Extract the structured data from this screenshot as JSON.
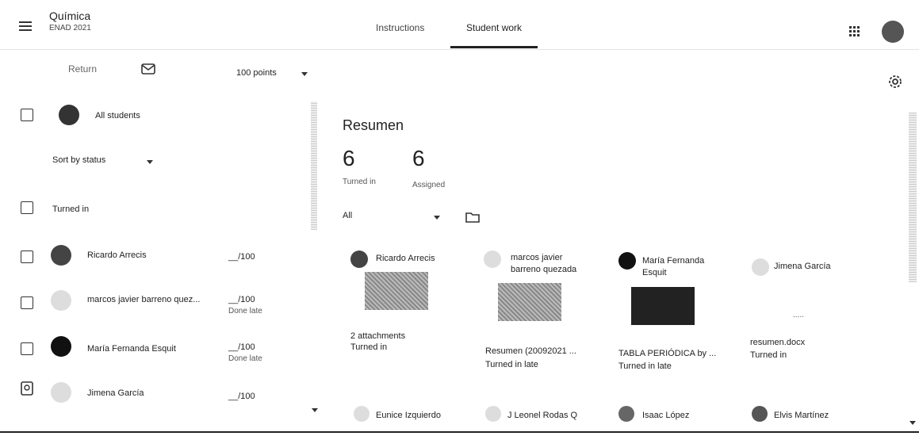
{
  "header": {
    "class_title": "Química",
    "class_subtitle": "ENAD 2021",
    "tabs": [
      {
        "label": "Instructions"
      },
      {
        "label": "Student work"
      }
    ],
    "accent": "#1e1e1e"
  },
  "toolbar": {
    "return_label": "Return",
    "points_label": "100 points"
  },
  "left": {
    "all_students": "All students",
    "sort_label": "Sort by status",
    "group_turned_in": "Turned in",
    "students": [
      {
        "name": "Ricardo Arrecis",
        "grade": "__/100",
        "status": ""
      },
      {
        "name": "marcos javier barreno quez...",
        "grade": "__/100",
        "status": "Done late"
      },
      {
        "name": "María Fernanda Esquit",
        "grade": "__/100",
        "status": "Done late"
      },
      {
        "name": "Jimena García",
        "grade": "__/100",
        "status": ""
      }
    ]
  },
  "main": {
    "assignment_title": "Resumen",
    "stats": [
      {
        "count": "6",
        "label": "Turned in"
      },
      {
        "count": "6",
        "label": "Assigned"
      }
    ],
    "filter_label": "All",
    "cards": [
      {
        "name": "Ricardo Arrecis",
        "file": "2 attachments",
        "status": "Turned in"
      },
      {
        "name": "marcos javier barreno quezada",
        "file": "Resumen (20092021 ...",
        "status": "Turned in late"
      },
      {
        "name": "María Fernanda Esquit",
        "file": "TABLA PERIÓDICA by ...",
        "status": "Turned in late"
      },
      {
        "name": "Jimena García",
        "file": "resumen.docx",
        "status": "Turned in"
      }
    ],
    "bottom_cards": [
      {
        "name": "Eunice Izquierdo"
      },
      {
        "name": "J Leonel Rodas Q"
      },
      {
        "name": "Isaac López"
      },
      {
        "name": "Elvis Martínez"
      }
    ],
    "doc_placeholder": "....."
  }
}
